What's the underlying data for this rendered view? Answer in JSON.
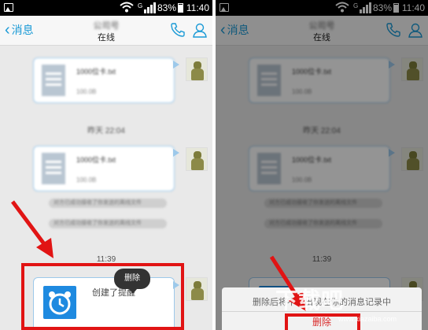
{
  "status_bar": {
    "signal_label": "G",
    "battery": "83%",
    "time": "11:40"
  },
  "nav": {
    "back_label": "消息",
    "contact_name": "公司号",
    "contact_status": "在线"
  },
  "colors": {
    "accent": "#1a9ad6",
    "highlight": "#e11414",
    "alarm_icon": "#1e8ae0"
  },
  "chat": {
    "file1": {
      "name": "1000位卡.txt",
      "meta": "100.0B"
    },
    "time1": "昨天 22:04",
    "file2": {
      "name": "1000位卡.txt",
      "meta": "100.0B"
    },
    "system_notes": [
      "对方已成功接收了你发送的离线文件",
      "对方已成功接收了你发送的离线文件"
    ],
    "time2": "11:39",
    "alarm_message": "创建了提醒",
    "tooltip_delete": "删除"
  },
  "dialog": {
    "message": "删除后将不会出现在你的消息记录中",
    "delete_label": "删除"
  },
  "watermark": {
    "logo": "下载吧",
    "site": "www.xiazaiba.com"
  }
}
